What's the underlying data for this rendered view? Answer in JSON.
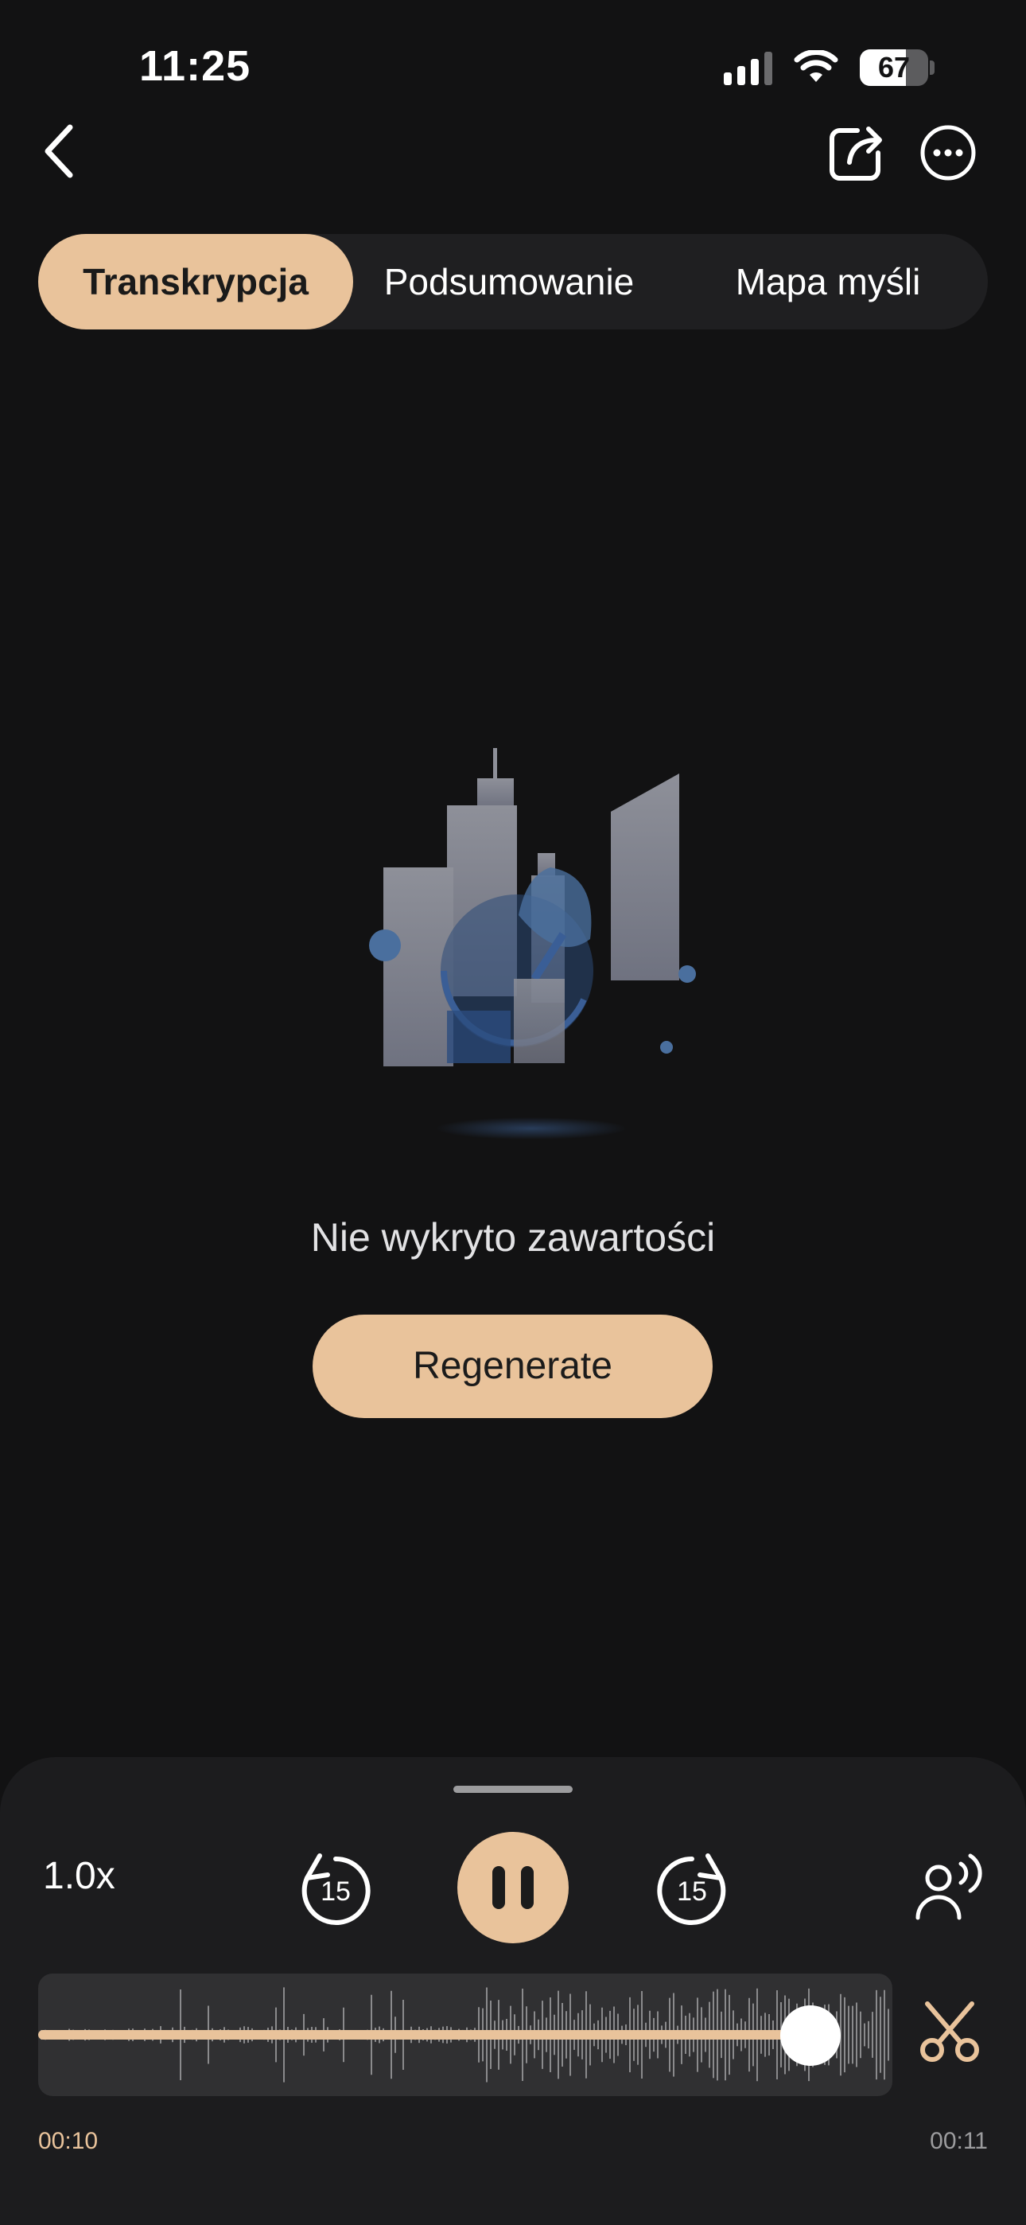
{
  "status_bar": {
    "time": "11:25",
    "battery_percent": "67",
    "signal_bars": 4,
    "icons": [
      "cellular-signal-icon",
      "wifi-icon",
      "battery-icon"
    ]
  },
  "header": {
    "icons": [
      "back-chevron-icon",
      "share-icon",
      "more-icon"
    ]
  },
  "tabs": [
    {
      "label": "Transkrypcja",
      "selected": true
    },
    {
      "label": "Podsumowanie",
      "selected": false
    },
    {
      "label": "Mapa myśli",
      "selected": false
    }
  ],
  "empty_state": {
    "illustration": "city-satellite-illustration",
    "message": "Nie wykryto zawartości",
    "button_label": "Regenerate"
  },
  "player": {
    "speed": "1.0x",
    "skip_back": "15",
    "skip_forward": "15",
    "state": "playing",
    "current_time": "00:10",
    "total_time": "00:11",
    "progress_fraction": 0.9,
    "icons": [
      "rewind-15-icon",
      "pause-icon",
      "forward-15-icon",
      "speaker-person-icon",
      "scissors-icon"
    ]
  },
  "colors": {
    "accent": "#e9c39b",
    "background": "#121213",
    "panel": "#1c1c1e",
    "text_secondary": "#9c9c9e"
  }
}
